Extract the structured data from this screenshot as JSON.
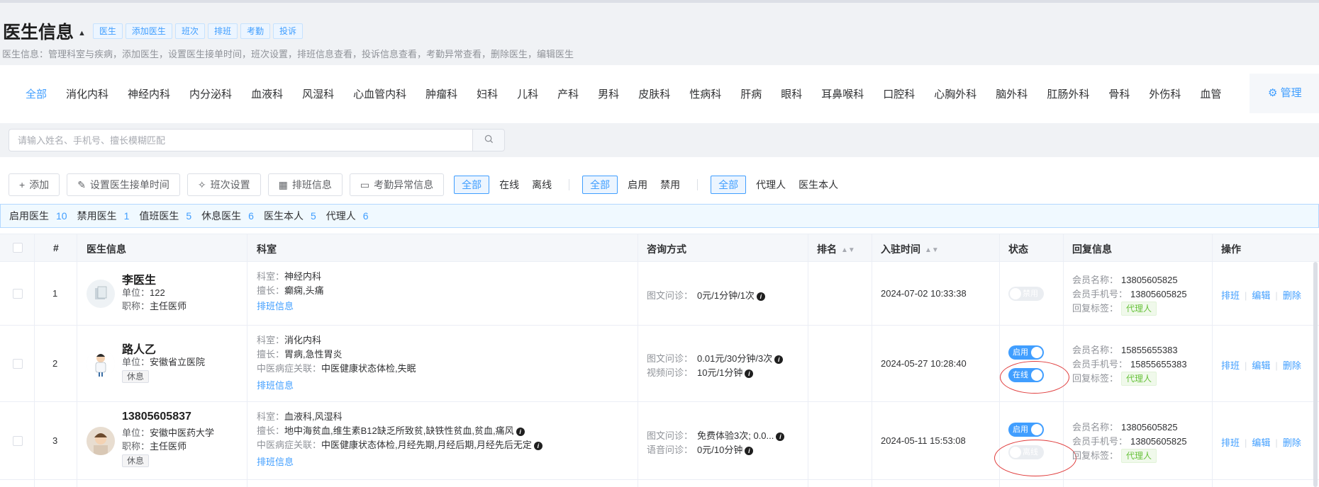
{
  "header": {
    "title": "医生信息",
    "tags": [
      "医生",
      "添加医生",
      "班次",
      "排班",
      "考勤",
      "投诉"
    ],
    "subtitle": "医生信息：管理科室与疾病，添加医生，设置医生接单时间，班次设置，排班信息查看，投诉信息查看，考勤异常查看，删除医生，编辑医生"
  },
  "departments": [
    "全部",
    "消化内科",
    "神经内科",
    "内分泌科",
    "血液科",
    "风湿科",
    "心血管内科",
    "肿瘤科",
    "妇科",
    "儿科",
    "产科",
    "男科",
    "皮肤科",
    "性病科",
    "肝病",
    "眼科",
    "耳鼻喉科",
    "口腔科",
    "心胸外科",
    "脑外科",
    "肛肠外科",
    "骨科",
    "外伤科",
    "血管"
  ],
  "manage_label": "管理",
  "search": {
    "placeholder": "请输入姓名、手机号、擅长模糊匹配"
  },
  "toolbar": {
    "add": "添加",
    "set_time": "设置医生接单时间",
    "shift": "班次设置",
    "schedule": "排班信息",
    "attendance": "考勤异常信息",
    "online_filter": [
      "全部",
      "在线",
      "离线"
    ],
    "enable_filter": [
      "全部",
      "启用",
      "禁用"
    ],
    "agent_filter": [
      "全部",
      "代理人",
      "医生本人"
    ]
  },
  "stats": [
    {
      "label": "启用医生",
      "value": "10"
    },
    {
      "label": "禁用医生",
      "value": "1"
    },
    {
      "label": "值班医生",
      "value": "5"
    },
    {
      "label": "休息医生",
      "value": "6"
    },
    {
      "label": "医生本人",
      "value": "5"
    },
    {
      "label": "代理人",
      "value": "6"
    }
  ],
  "table": {
    "headers": {
      "index": "#",
      "doctor": "医生信息",
      "dept": "科室",
      "consult": "咨询方式",
      "rank": "排名",
      "join": "入驻时间",
      "status": "状态",
      "reply": "回复信息",
      "ops": "操作"
    },
    "labels": {
      "unit": "单位：",
      "title": "职称：",
      "dept": "科室：",
      "specialty": "擅长：",
      "tcm": "中医病症关联：",
      "schedule_link": "排班信息",
      "member_name": "会员名称：",
      "member_phone": "会员手机号：",
      "reply_tag": "回复标签：",
      "op_schedule": "排班",
      "op_edit": "编辑",
      "op_delete": "删除"
    },
    "rows": [
      {
        "index": "1",
        "name": "李医生",
        "unit": "122",
        "title": "主任医师",
        "dept": "神经内科",
        "specialty": "癫痫,头痛",
        "consult": [
          {
            "k": "图文问诊：",
            "v": "0元/1分钟/1次"
          }
        ],
        "join": "2024-07-02 10:33:38",
        "switches": [
          {
            "label": "禁用",
            "on": false
          }
        ],
        "member_name": "13805605825",
        "member_phone": "13805605825",
        "reply_tag": "代理人"
      },
      {
        "index": "2",
        "name": "路人乙",
        "unit": "安徽省立医院",
        "rest": "休息",
        "dept": "消化内科",
        "specialty": "胃病,急性胃炎",
        "tcm": "中医健康状态体检,失眠",
        "consult": [
          {
            "k": "图文问诊：",
            "v": "0.01元/30分钟/3次"
          },
          {
            "k": "视频问诊：",
            "v": "10元/1分钟"
          }
        ],
        "join": "2024-05-27 10:28:40",
        "switches": [
          {
            "label": "启用",
            "on": true
          },
          {
            "label": "在线",
            "on": true
          }
        ],
        "member_name": "15855655383",
        "member_phone": "15855655383",
        "reply_tag": "代理人"
      },
      {
        "index": "3",
        "name": "13805605837",
        "unit": "安徽中医药大学",
        "title": "主任医师",
        "rest": "休息",
        "dept": "血液科,风湿科",
        "specialty": "地中海贫血,维生素B12缺乏所致贫,缺铁性贫血,贫血,痛风",
        "tcm": "中医健康状态体检,月经先期,月经后期,月经先后无定",
        "consult": [
          {
            "k": "图文问诊：",
            "v": "免费体验3次; 0.0..."
          },
          {
            "k": "语音问诊：",
            "v": "0元/10分钟"
          }
        ],
        "join": "2024-05-11 15:53:08",
        "switches": [
          {
            "label": "启用",
            "on": true
          },
          {
            "label": "离线",
            "on": false
          }
        ],
        "member_name": "13805605825",
        "member_phone": "13805605825",
        "reply_tag": "代理人"
      }
    ]
  }
}
